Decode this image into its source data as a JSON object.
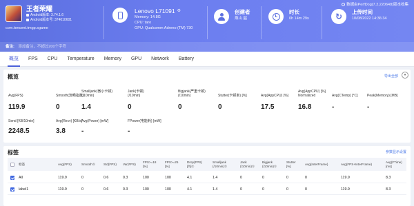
{
  "notice": "数据由PerfDog(7.2.220648)版本收集",
  "app": {
    "name": "王者荣耀",
    "android_version": "Android版本: 3.74.1.6",
    "android_build": "Android版本号: 374010601",
    "package": "com.tencent.tmgp.sgame"
  },
  "device": {
    "name": "Lenovo L71091",
    "memory": "Memory: 14.8G",
    "cpu": "CPU: taro",
    "gpu": "GPU: Qualcomm Adreno (TM) 730"
  },
  "creator": {
    "label": "创建者",
    "value": "燕山 韶"
  },
  "duration": {
    "label": "时长",
    "value": "0h 14m 29s"
  },
  "upload": {
    "label": "上传时间",
    "value": "10/08/2022 14:36:34"
  },
  "remark": {
    "label": "备注:",
    "placeholder": "添加备注，不超过200个字符"
  },
  "tabs": [
    "概览",
    "FPS",
    "CPU",
    "Temperature",
    "Memory",
    "GPU",
    "Network",
    "Battery"
  ],
  "overview": {
    "title": "概览",
    "export": "导出全部",
    "row1": [
      {
        "label": "Avg(FPS)",
        "value": "119.9"
      },
      {
        "label": "Smooth(流畅指数)",
        "value": "0"
      },
      {
        "label": "Smalljank(微小卡顿)\n(/10min)",
        "value": "1.4"
      },
      {
        "label": "Jank(卡顿)\n(/10min)",
        "value": "0"
      },
      {
        "label": "Bigjank(严重卡顿)\n(/10min)",
        "value": "0"
      },
      {
        "label": "Stutter(卡顿率) [%]",
        "value": "0"
      },
      {
        "label": "Avg(AppCPU) [%]",
        "value": "17.5"
      },
      {
        "label": "Avg(AppCPU) [%]\nNormalized",
        "value": "16.8"
      },
      {
        "label": "Avg(CTemp) [°C]",
        "value": "-"
      },
      {
        "label": "Peak(Memory) [MB]",
        "value": "-"
      }
    ],
    "row2": [
      {
        "label": "Send [KB/10min]",
        "value": "2248.5"
      },
      {
        "label": "Avg(Recv) [KB/s]",
        "value": "3.8"
      },
      {
        "label": "Avg(Power) [mW]",
        "value": "-"
      },
      {
        "label": "FPower(电能耗) [mW]",
        "value": "-"
      }
    ]
  },
  "labels_section": {
    "title": "标签",
    "settings": "参数显示设置",
    "columns": [
      "标签",
      "Avg(FPS)",
      "Smooth①",
      "Std(FPS)",
      "Var(FPS)",
      "FPS>=18\n[%]",
      "FPS>=25\n[%]",
      "Drop(FPS)\n[/h]①",
      "Smalljank\n(/10min)①",
      "Jank\n(/10min)①",
      "Bigjank\n(/10min)①",
      "Stutter\n[%]",
      "Avg(InterFrame)",
      "Avg(FPS+InterFrame)",
      "Avg(FTime)\n[ms]"
    ],
    "rows": [
      [
        "All",
        "119.9",
        "0",
        "0.6",
        "0.3",
        "100",
        "100",
        "4.1",
        "1.4",
        "0",
        "0",
        "0",
        "0",
        "119.9",
        "8.3"
      ],
      [
        "label1",
        "119.9",
        "0",
        "0.6",
        "0.3",
        "100",
        "100",
        "4.1",
        "1.4",
        "0",
        "0",
        "0",
        "0",
        "119.9",
        "8.3"
      ]
    ]
  }
}
